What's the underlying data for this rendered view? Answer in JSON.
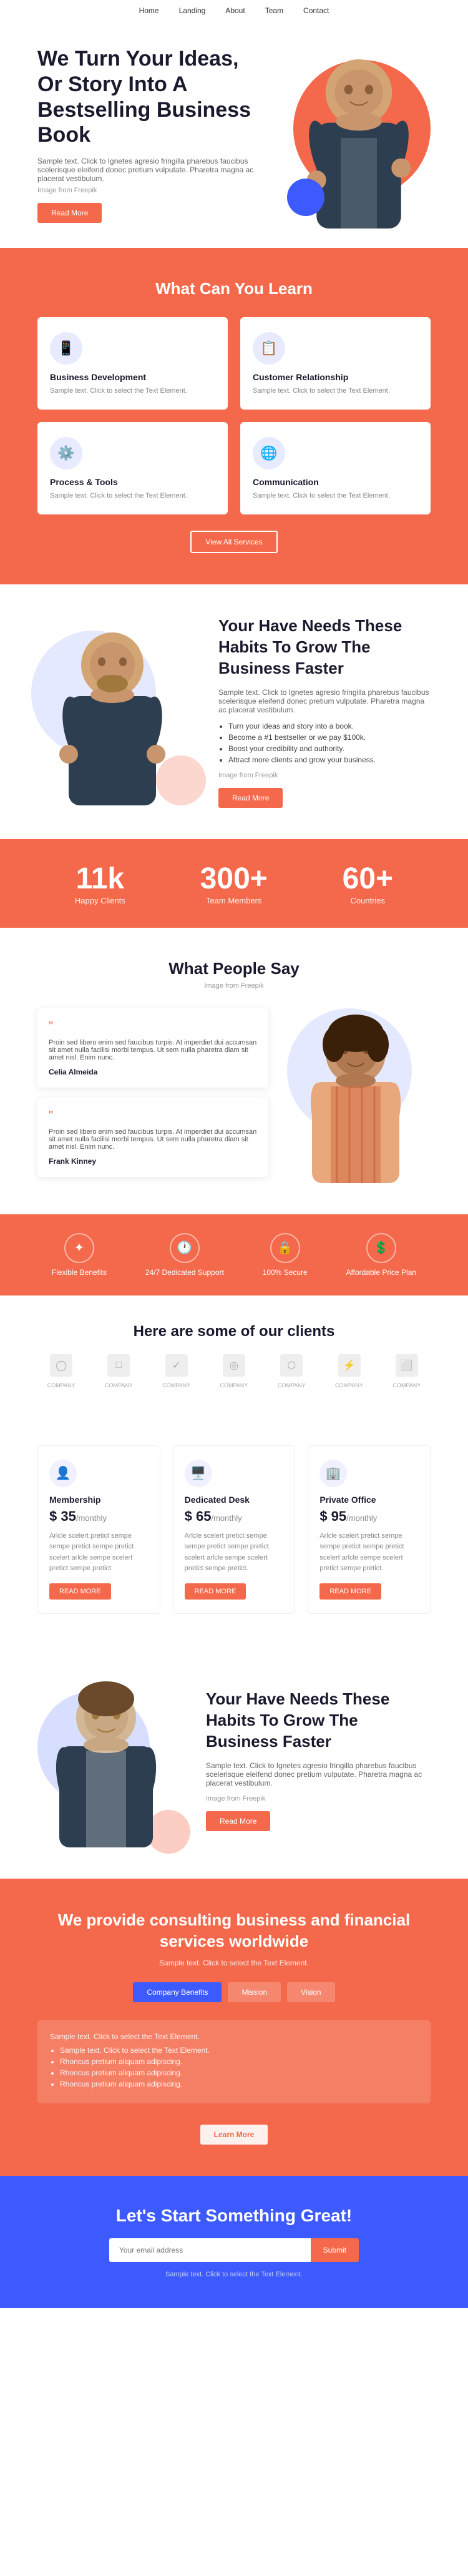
{
  "nav": {
    "links": [
      "Home",
      "Landing",
      "About",
      "Team",
      "Contact"
    ]
  },
  "hero": {
    "title": "We Turn Your Ideas, Or Story Into A Bestselling Business Book",
    "description": "Sample text. Click to Ignetes agresio fringilla pharebus faucibus scelerisque eleifend donec pretium vulputate. Pharetra magna ac placerat vestibulum.",
    "image_from": "Image from Freepik",
    "read_more": "Read More"
  },
  "learn": {
    "title": "What Can You Learn",
    "cards": [
      {
        "icon": "📱",
        "title": "Business Development",
        "text": "Sample text. Click to select the Text Element."
      },
      {
        "icon": "📋",
        "title": "Customer Relationship",
        "text": "Sample text. Click to select the Text Element."
      },
      {
        "icon": "⚙️",
        "title": "Process & Tools",
        "text": "Sample text. Click to select the Text Element."
      },
      {
        "icon": "🌐",
        "title": "Communication",
        "text": "Sample text. Click to select the Text Element."
      }
    ],
    "view_all": "View All Services"
  },
  "habits": {
    "title": "Your Have Needs These Habits To Grow The Business Faster",
    "description": "Sample text. Click to Ignetes agresio fringilla pharebus faucibus scelerisque eleifend donec pretium vulputate. Pharetra magna ac placerat vestibulum.",
    "bullets": [
      "Turn your ideas and story into a book.",
      "Become a #1 bestseller or we pay $100k.",
      "Boost your credibility and authority.",
      "Attract more clients and grow your business."
    ],
    "image_from": "Image from Freepik",
    "read_more": "Read More"
  },
  "stats": [
    {
      "number": "11k",
      "label": "Happy Clients"
    },
    {
      "number": "300+",
      "label": "Team Members"
    },
    {
      "number": "60+",
      "label": "Countries"
    }
  ],
  "testimonials": {
    "title": "What People Say",
    "image_from": "Image from Freepik",
    "items": [
      {
        "text": "Proin sed libero enim sed faucibus turpis. At imperdiet dui accumsan sit amet nulla facilisi morbi tempus. Ut sem nulla pharetra diam sit amet nisl. Enim nunc.",
        "author": "Celia Almeida"
      },
      {
        "text": "Proin sed libero enim sed faucibus turpis. At imperdiet dui accumsan sit amet nulla facilisi morbi tempus. Ut sem nulla pharetra diam sit amet nisl. Enim nunc.",
        "author": "Frank Kinney"
      }
    ]
  },
  "features": [
    {
      "icon": "✦",
      "label": "Flexible Benefits"
    },
    {
      "icon": "🕐",
      "label": "24/7 Dedicated Support"
    },
    {
      "icon": "🔒",
      "label": "100% Secure"
    },
    {
      "icon": "💲",
      "label": "Affordable Price Plan"
    }
  ],
  "clients": {
    "title": "Here are some of our clients",
    "logos": [
      "COMPANY",
      "COMPANY",
      "COMPANY",
      "COMPANY",
      "COMPANY",
      "COMPANY",
      "COMPANY"
    ]
  },
  "pricing": {
    "plans": [
      {
        "icon": "👤",
        "title": "Membership",
        "price": "$ 35",
        "period": "/monthly",
        "description": "Arlcle scelert pretict sempe sempe pretict sempe pretict scelert arlcle sempe scelert pretict sempe pretict.",
        "cta": "READ MORE"
      },
      {
        "icon": "🖥️",
        "title": "Dedicated Desk",
        "price": "$ 65",
        "period": "/monthly",
        "description": "Arlcle scelert pretict sempe sempe pretict sempe pretict scelert arlcle sempe scelert pretict sempe pretict.",
        "cta": "READ MORE"
      },
      {
        "icon": "🏢",
        "title": "Private Office",
        "price": "$ 95",
        "period": "/monthly",
        "description": "Arlcle scelert pretict sempe sempe pretict sempe pretict scelert arlcle sempe scelert pretict sempe pretict.",
        "cta": "READ MORE"
      }
    ]
  },
  "habits2": {
    "title": "Your Have Needs These Habits To Grow The Business Faster",
    "description": "Sample text. Click to Ignetes agresio fringilla pharebus faucibus scelerisque eleifend donec pretium vulputate. Pharetra magna ac placerat vestibulum.",
    "image_from": "Image from Freepik",
    "read_more": "Read More"
  },
  "consulting": {
    "title": "We provide consulting business and financial services worldwide",
    "subtitle": "Sample text. Click to select the Text Element.",
    "tabs": [
      {
        "label": "Company Benefits",
        "active": true
      },
      {
        "label": "Mission",
        "active": false
      },
      {
        "label": "Vision",
        "active": false
      }
    ],
    "content": {
      "text": "Sample text. Click to select the Text Element.",
      "bullets": [
        "Sample text. Click to select the Text Element.",
        "Rhoncus pretium aliquam adipiscing.",
        "Rhoncus pretium aliquam adipiscing.",
        "Rhoncus pretium aliquam adipiscing."
      ]
    },
    "learn_more": "Learn More"
  },
  "cta": {
    "title": "Let's Start Something Great!",
    "placeholder": "Your email address",
    "submit": "Submit",
    "sub": "Sample text. Click to select the Text Element."
  }
}
